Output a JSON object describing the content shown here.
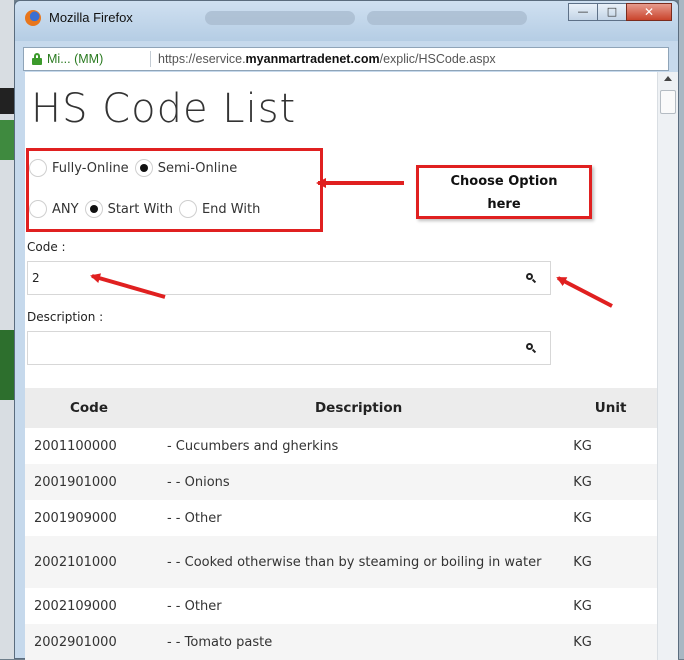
{
  "window": {
    "title": "Mozilla Firefox",
    "controls": {
      "minimize": "—",
      "maximize": "□",
      "close": "✕"
    }
  },
  "urlbar": {
    "identity": "Mi... (MM)",
    "url_prefix": "https://eservice.",
    "url_domain": "myanmartradenet.com",
    "url_path": "/explic/HSCode.aspx"
  },
  "page": {
    "title": "HS Code List",
    "mode_options": [
      {
        "label": "Fully-Online",
        "selected": false
      },
      {
        "label": "Semi-Online",
        "selected": true
      }
    ],
    "match_options": [
      {
        "label": "ANY",
        "selected": false
      },
      {
        "label": "Start With",
        "selected": true
      },
      {
        "label": "End With",
        "selected": false
      }
    ],
    "code_label": "Code :",
    "code_value": "2",
    "description_label": "Description :",
    "description_value": ""
  },
  "annotation": {
    "callout_line1": "Choose Option",
    "callout_line2": "here",
    "color": "#e02020"
  },
  "table": {
    "headers": {
      "code": "Code",
      "description": "Description",
      "unit": "Unit"
    },
    "rows": [
      {
        "code": "2001100000",
        "description": "- Cucumbers and gherkins",
        "unit": "KG"
      },
      {
        "code": "2001901000",
        "description": "- - Onions",
        "unit": "KG"
      },
      {
        "code": "2001909000",
        "description": "- - Other",
        "unit": "KG"
      },
      {
        "code": "2002101000",
        "description": "- - Cooked otherwise than by steaming or boiling in water",
        "unit": "KG"
      },
      {
        "code": "2002109000",
        "description": "- - Other",
        "unit": "KG"
      },
      {
        "code": "2002901000",
        "description": "- - Tomato paste",
        "unit": "KG"
      }
    ]
  },
  "icons": [
    "firefox-icon",
    "lock-icon",
    "search-icon",
    "minimize-icon",
    "maximize-icon",
    "close-icon"
  ]
}
